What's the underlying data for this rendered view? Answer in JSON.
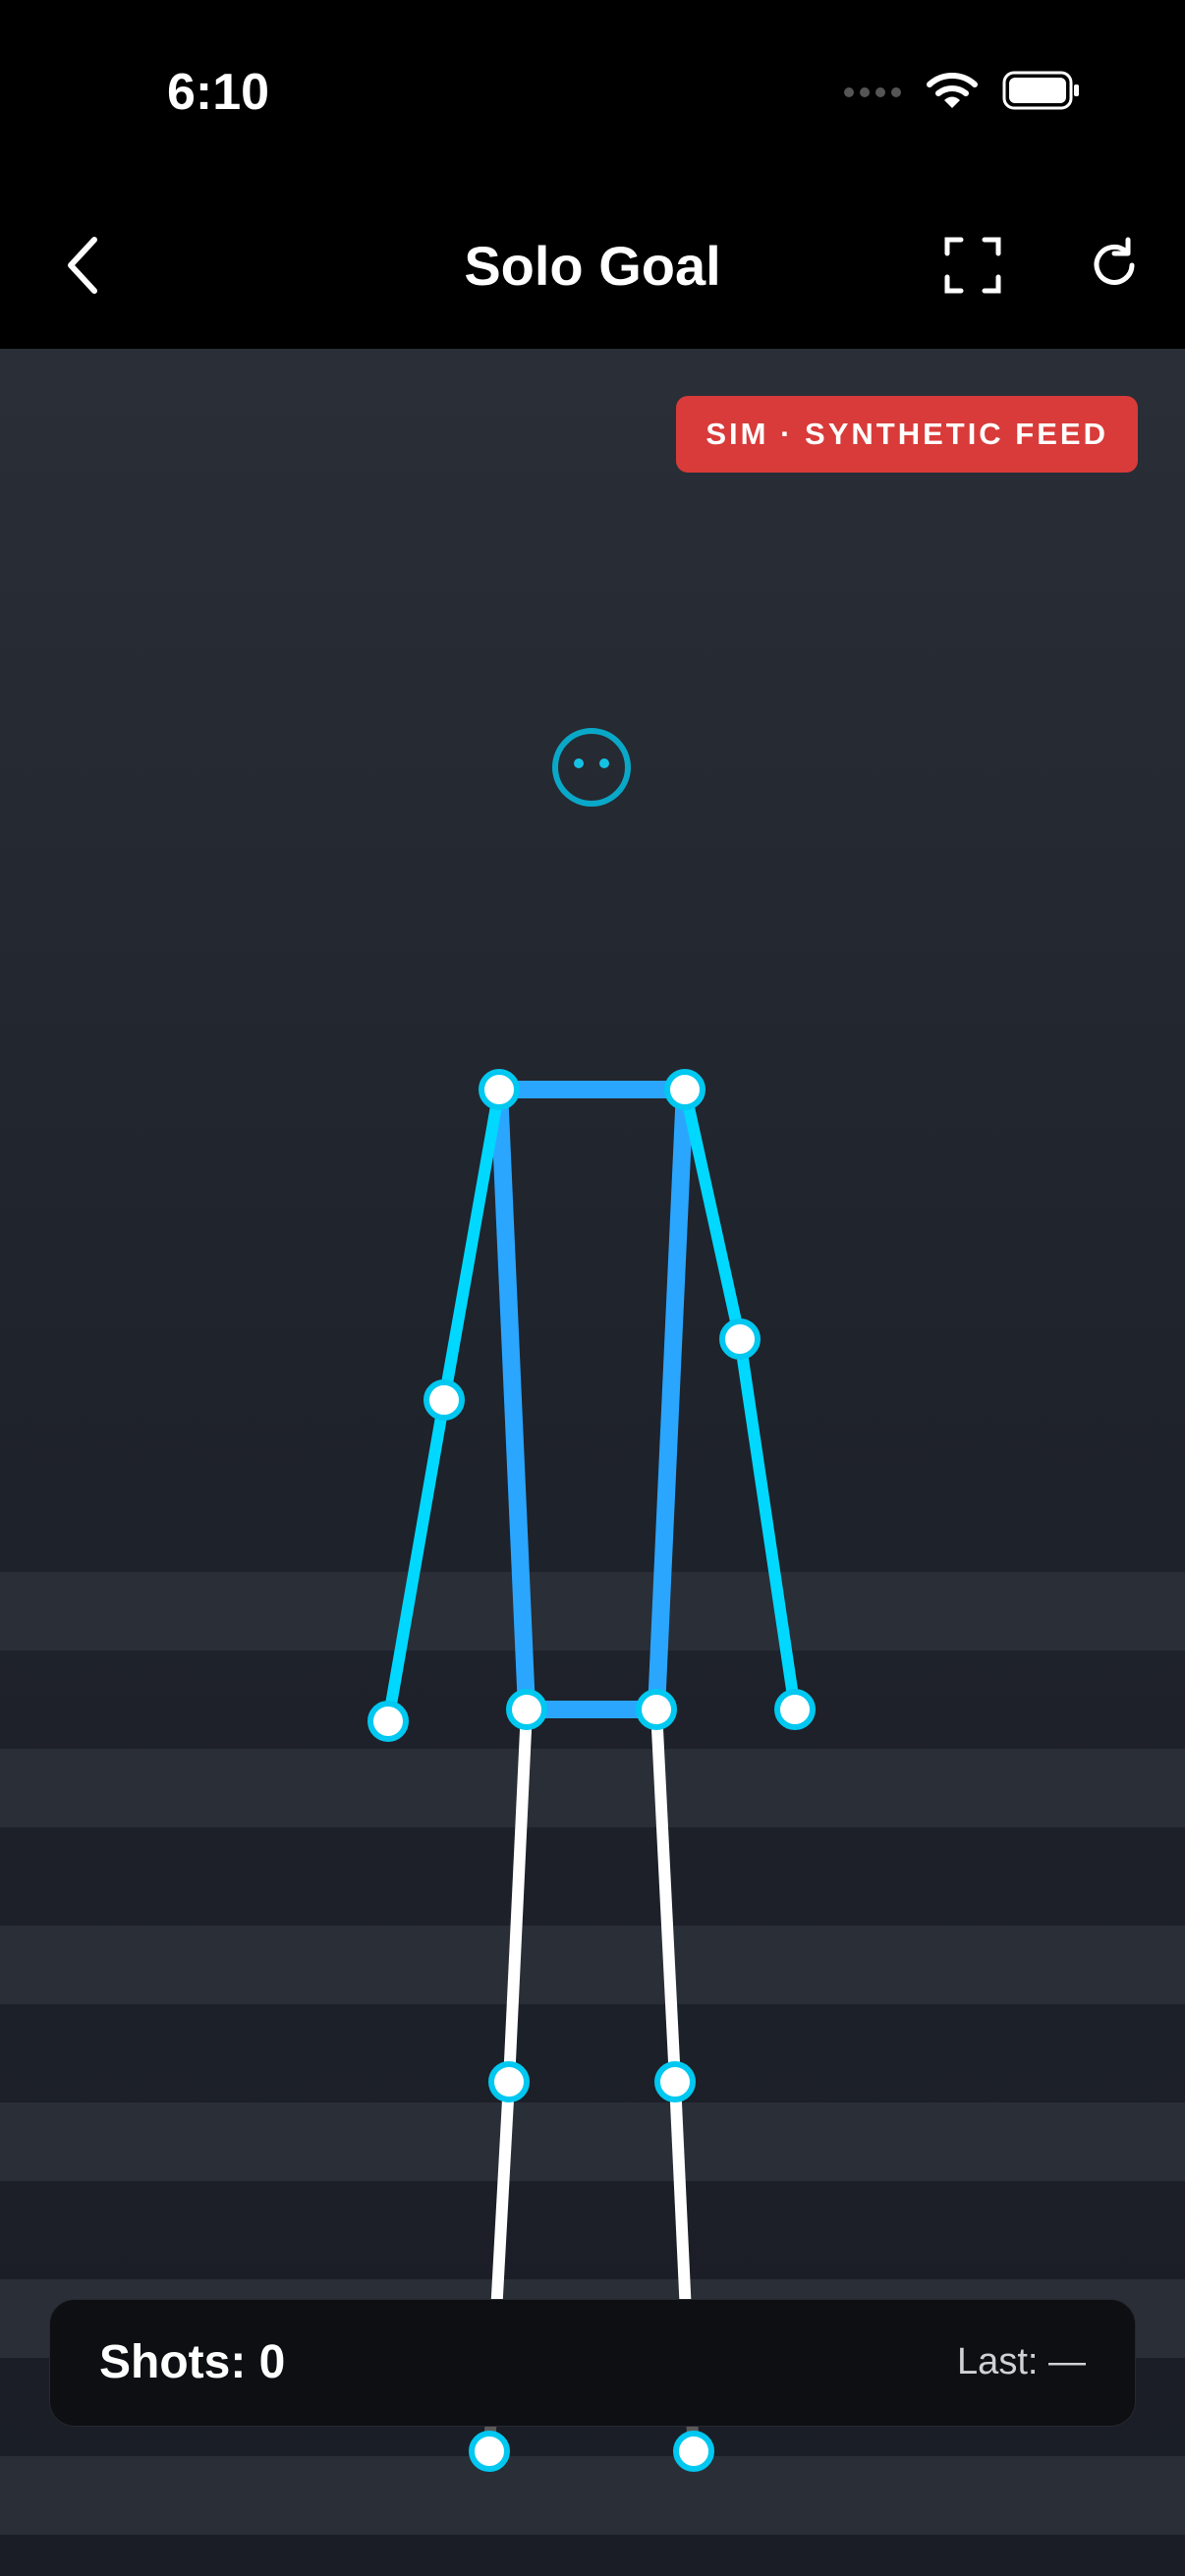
{
  "status": {
    "time": "6:10"
  },
  "nav": {
    "title": "Solo Goal",
    "back_icon": "chevron-left-icon",
    "fullscreen_icon": "fullscreen-icon",
    "refresh_icon": "refresh-icon"
  },
  "badge": {
    "text": "SIM · SYNTHETIC FEED",
    "color": "#d83b39"
  },
  "stats": {
    "shots": "Shots: 0",
    "last": "Last: —"
  },
  "colors": {
    "arm": "#00d8ff",
    "torso": "#2aa6ff",
    "leg": "#ffffff",
    "joint_ring": "#00c8f0",
    "joint_fill": "#ffffff",
    "head": "#0aa8c8"
  }
}
